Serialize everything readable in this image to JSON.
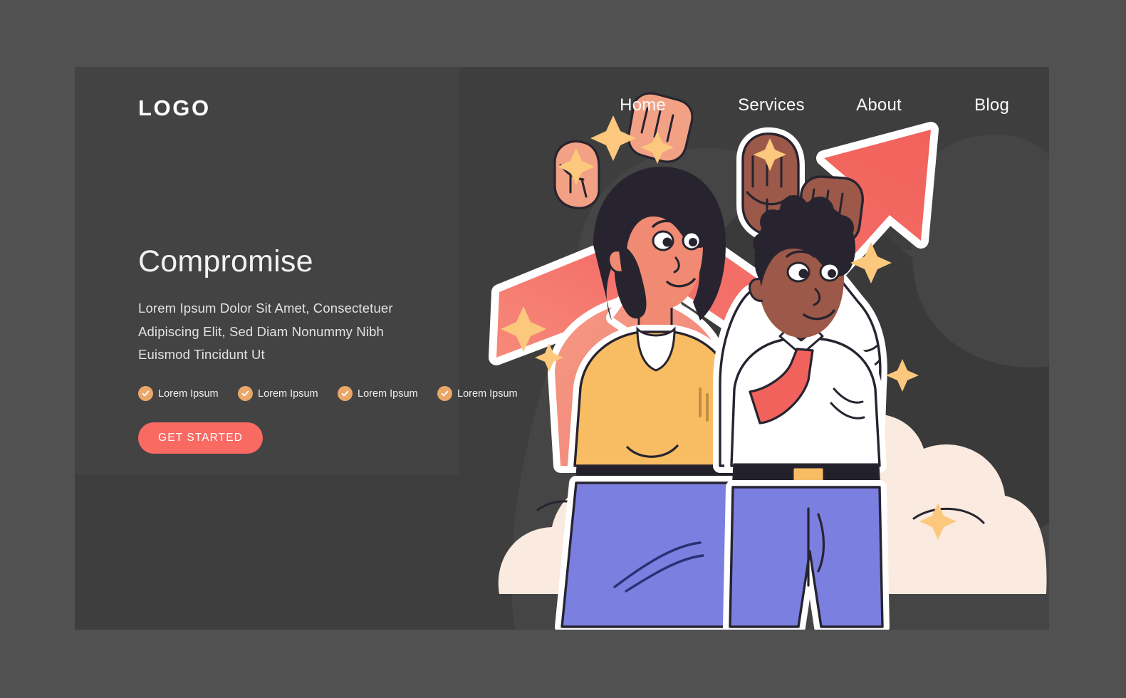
{
  "page": {
    "background_color": "#515151",
    "card_color": "#3e3e3e",
    "panel_color": "#434343",
    "accent_color": "#f96a63",
    "badge_color": "#eaa768"
  },
  "header": {
    "logo": "LOGO",
    "nav": [
      {
        "label": "Home"
      },
      {
        "label": "Services"
      },
      {
        "label": "About"
      },
      {
        "label": "Blog"
      }
    ]
  },
  "hero": {
    "title": "Compromise",
    "subtitle": "Lorem Ipsum Dolor Sit Amet, Consectetuer Adipiscing Elit, Sed Diam Nonummy Nibh Euismod Tincidunt Ut",
    "features": [
      {
        "label": "Lorem Ipsum",
        "icon": "check-circle-icon"
      },
      {
        "label": "Lorem Ipsum",
        "icon": "check-circle-icon"
      },
      {
        "label": "Lorem Ipsum",
        "icon": "check-circle-icon"
      },
      {
        "label": "Lorem Ipsum",
        "icon": "check-circle-icon"
      }
    ],
    "cta_label": "GET STARTED"
  },
  "illustration": {
    "name": "two-people-lifting-growth-arrow",
    "description": "Flat illustration of a woman and a man raising a large red upward arrow above their heads, standing in clouds with yellow sparkles on a dark background",
    "colors": {
      "arrow_red": "#f2625c",
      "arrow_red_light": "#f78a7a",
      "outline_white": "#ffffff",
      "cloud_cream": "#faeadf",
      "sparkle_yellow": "#fbc87d",
      "skirt_blue": "#7b7fe0",
      "pants_blue": "#7b7fe0",
      "blouse_yellow": "#f8bd63",
      "shirt_white": "#ffffff",
      "tie_red": "#f2625c",
      "skin_light": "#f08a72",
      "skin_dark": "#9c5848",
      "hair_dark": "#272430",
      "belt_black": "#22212a",
      "blob_dark": "#454545",
      "blob_darker": "#3a3a3a"
    }
  }
}
